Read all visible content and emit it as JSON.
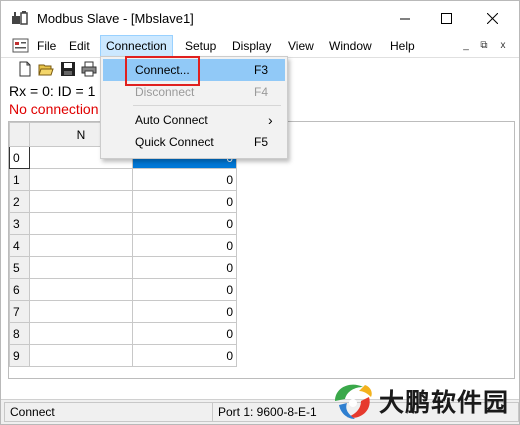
{
  "window": {
    "title": "Modbus Slave - [Mbslave1]"
  },
  "menubar": {
    "items": [
      "File",
      "Edit",
      "Connection",
      "Setup",
      "Display",
      "View",
      "Window",
      "Help"
    ],
    "active": "Connection",
    "mdi_controls": [
      "_",
      "⧉",
      "x"
    ]
  },
  "toolbar": {
    "icons": [
      "new-file-icon",
      "open-folder-icon",
      "save-icon",
      "print-icon"
    ]
  },
  "info": {
    "line1": "Rx = 0: ID = 1",
    "line2": "No connection"
  },
  "grid": {
    "header_partial": "N",
    "rows": [
      {
        "index": "0",
        "value": "0"
      },
      {
        "index": "1",
        "value": "0"
      },
      {
        "index": "2",
        "value": "0"
      },
      {
        "index": "3",
        "value": "0"
      },
      {
        "index": "4",
        "value": "0"
      },
      {
        "index": "5",
        "value": "0"
      },
      {
        "index": "6",
        "value": "0"
      },
      {
        "index": "7",
        "value": "0"
      },
      {
        "index": "8",
        "value": "0"
      },
      {
        "index": "9",
        "value": "0"
      }
    ],
    "selected_row": 0
  },
  "connection_menu": {
    "items": [
      {
        "label": "Connect...",
        "shortcut": "F3",
        "state": "highlighted"
      },
      {
        "label": "Disconnect",
        "shortcut": "F4",
        "state": "disabled"
      },
      {
        "label": "Auto Connect",
        "shortcut": "›",
        "state": "submenu"
      },
      {
        "label": "Quick Connect",
        "shortcut": "F5",
        "state": "normal"
      }
    ]
  },
  "statusbar": {
    "left": "Connect",
    "right": "Port 1: 9600-8-E-1"
  },
  "watermark": {
    "text": "大鹏软件园"
  },
  "colors": {
    "selection": "#0078d7",
    "menu_highlight": "#91c9f7",
    "annotation_box": "#e0201f",
    "error_text": "#e00000"
  }
}
